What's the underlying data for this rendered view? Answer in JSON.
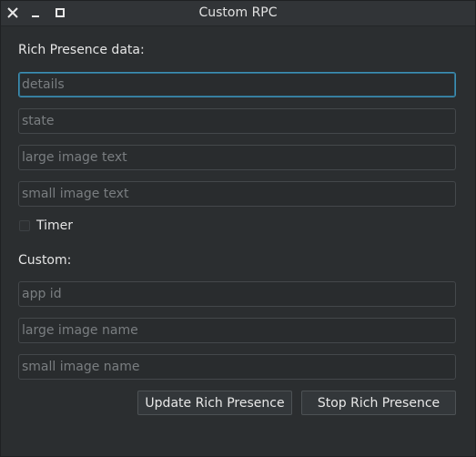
{
  "window": {
    "title": "Custom RPC"
  },
  "rich_presence": {
    "heading": "Rich Presence data:",
    "details_placeholder": "details",
    "state_placeholder": "state",
    "large_image_text_placeholder": "large image text",
    "small_image_text_placeholder": "small image text",
    "timer_label": "Timer",
    "timer_checked": false
  },
  "custom": {
    "heading": "Custom:",
    "app_id_placeholder": "app id",
    "large_image_name_placeholder": "large image name",
    "small_image_name_placeholder": "small image name"
  },
  "actions": {
    "update_label": "Update Rich Presence",
    "stop_label": "Stop Rich Presence"
  },
  "colors": {
    "background": "#2b2e30",
    "titlebar": "#313437",
    "focus_accent": "#3d8fb3",
    "text": "#e6e6e6",
    "placeholder": "#7a7e81"
  },
  "icons": {
    "close": "close-icon",
    "minimize": "minimize-icon",
    "maximize": "maximize-icon"
  }
}
